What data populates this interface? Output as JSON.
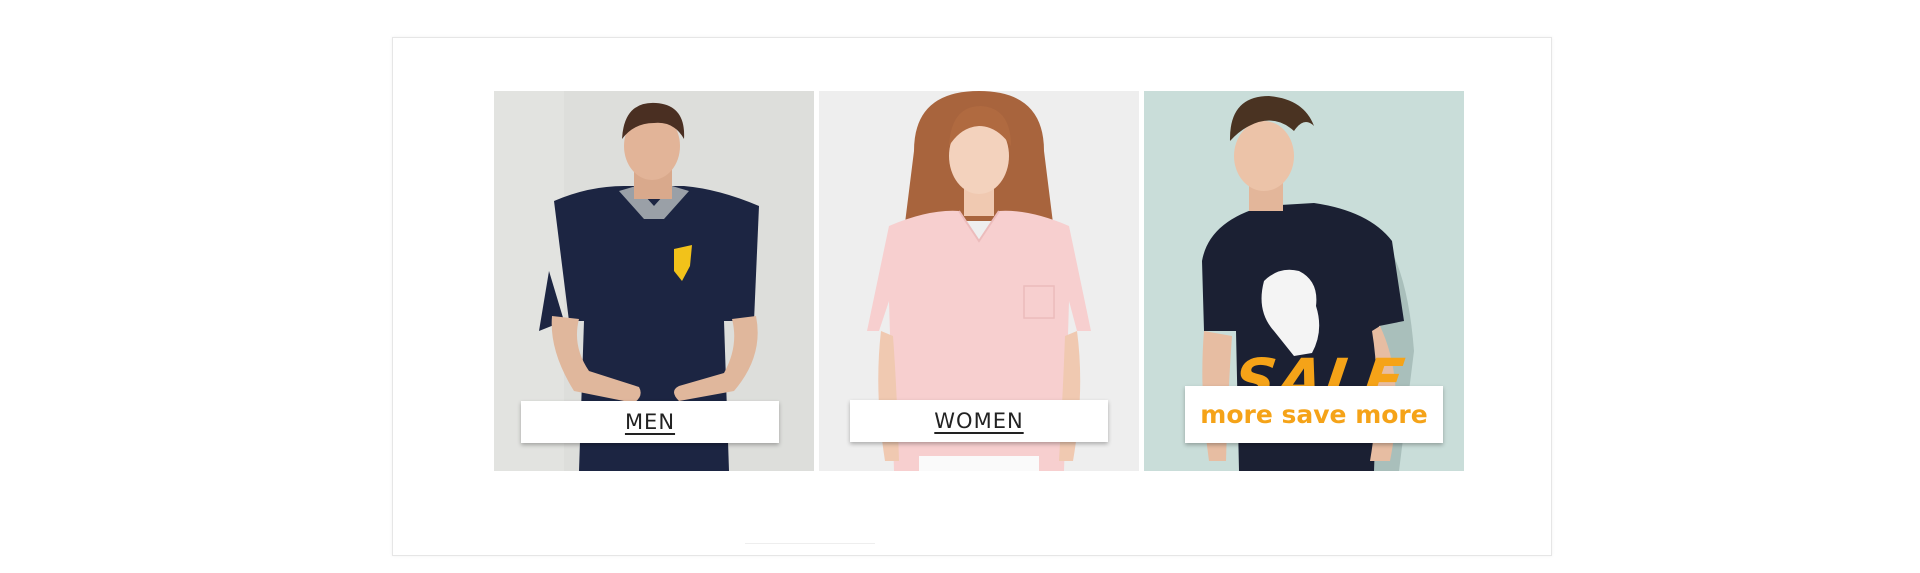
{
  "categories": [
    {
      "label": "MEN",
      "image": "men-polo-shirt-photo"
    },
    {
      "label": "WOMEN",
      "image": "women-pink-tshirt-photo"
    }
  ],
  "sale": {
    "title": "SALE",
    "subtitle": "more save more",
    "image": "men-graphic-tshirt-photo"
  },
  "colors": {
    "accent": "#f5a318",
    "men_background": "#dddedb",
    "women_background": "#eeeeee",
    "sale_background": "#c9ddd9",
    "navy_shirt": "#1c2542",
    "pink_shirt": "#f7cfcf",
    "label_text": "#222222"
  }
}
